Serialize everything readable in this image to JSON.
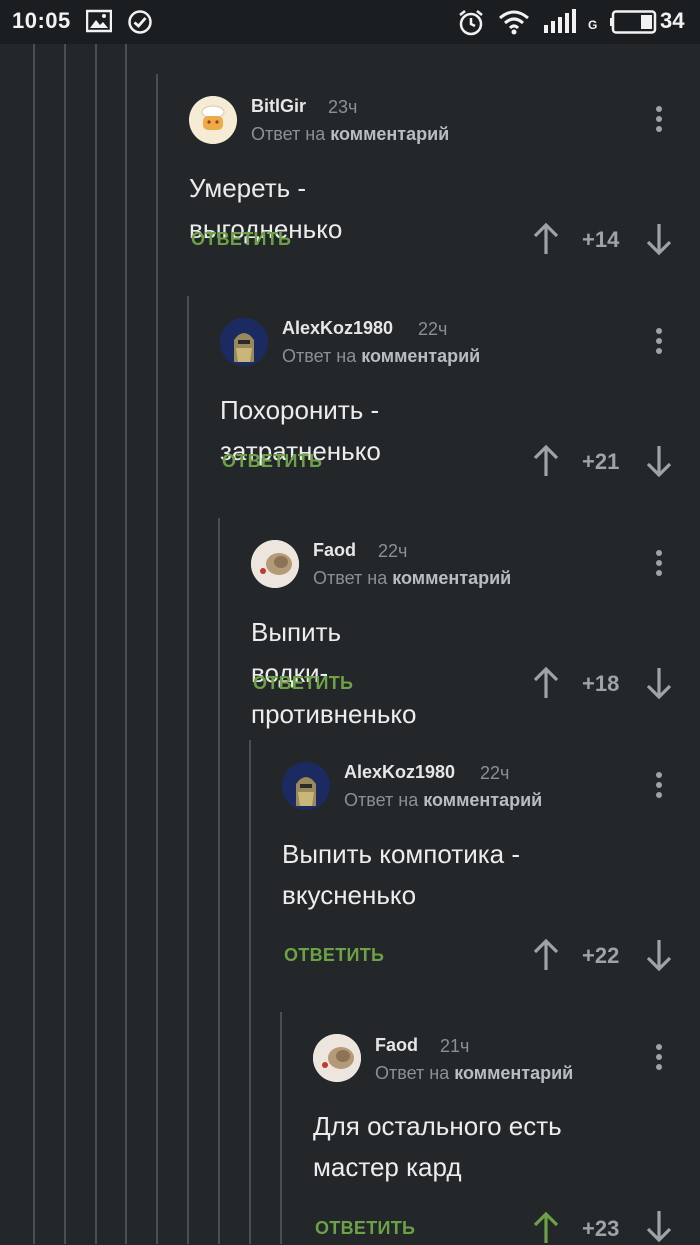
{
  "status_bar": {
    "time": "10:05",
    "battery": "34",
    "network": "G",
    "icons": [
      "image-icon",
      "check-circle-icon",
      "alarm-icon",
      "wifi-icon",
      "signal-icon",
      "battery-icon"
    ]
  },
  "reply_to_prefix": "Ответ на",
  "reply_to_target": "комментарий",
  "reply_label": "ОТВЕТИТЬ",
  "colors": {
    "background": "#23272a",
    "reply_green": "#6da146",
    "upvoted_green": "#6da146",
    "neutral_arrow": "#9ea3a7"
  },
  "comments": [
    {
      "username": "BitlGir",
      "time": "23ч",
      "text": "Умереть - выгодненько",
      "score": "+14",
      "upvoted": false
    },
    {
      "username": "AlexKoz1980",
      "time": "22ч",
      "text": "Похоронить - затратненько",
      "score": "+21",
      "upvoted": false
    },
    {
      "username": "Faod",
      "time": "22ч",
      "text": "Выпить водки- противненько",
      "score": "+18",
      "upvoted": false
    },
    {
      "username": "AlexKoz1980",
      "time": "22ч",
      "text": "Выпить компотика - вкусненько",
      "score": "+22",
      "upvoted": false
    },
    {
      "username": "Faod",
      "time": "21ч",
      "text": "Для остального есть мастер кард",
      "score": "+23",
      "upvoted": true
    }
  ]
}
